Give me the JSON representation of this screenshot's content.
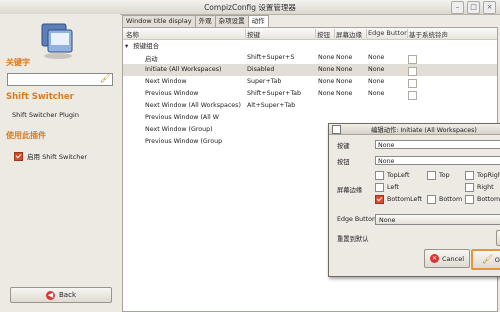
{
  "window": {
    "title": "CompizConfig 设置管理器"
  },
  "sidebar": {
    "filter_label": "关键字",
    "filter_value": "",
    "plugin_title": "Shift Switcher",
    "plugin_name": "Shift Switcher Plugin",
    "use_plugin_label": "使用此插件",
    "enable_label": "启用 Shift Switcher",
    "back_label": "Back"
  },
  "tabs": [
    "Window title display",
    "外观",
    "杂项设置",
    "动作"
  ],
  "active_tab": 3,
  "table": {
    "headers": [
      "名称",
      "按键",
      "按钮",
      "屏幕边缘",
      "Edge Button",
      "基于系统铃声"
    ],
    "group": "按键组合",
    "rows": [
      {
        "name": "启动",
        "key": "Shift+Super+S",
        "button": "None",
        "edge": "None",
        "edge_button": "None"
      },
      {
        "name": "Initiate (All Workspaces)",
        "key": "Disabled",
        "button": "None",
        "edge": "None",
        "edge_button": "None"
      },
      {
        "name": "Next Window",
        "key": "Super+Tab",
        "button": "None",
        "edge": "None",
        "edge_button": "None"
      },
      {
        "name": "Previous Window",
        "key": "Shift+Super+Tab",
        "button": "None",
        "edge": "None",
        "edge_button": "None"
      },
      {
        "name": "Next Window (All Workspaces)",
        "key": "Alt+Super+Tab",
        "button": "",
        "edge": "",
        "edge_button": ""
      },
      {
        "name": "Previous Window (All W",
        "key": "",
        "button": "",
        "edge": "",
        "edge_button": ""
      },
      {
        "name": "Next Window (Group)",
        "key": "",
        "button": "",
        "edge": "",
        "edge_button": ""
      },
      {
        "name": "Previous Window (Group",
        "key": "",
        "button": "",
        "edge": "",
        "edge_button": ""
      }
    ]
  },
  "dialog": {
    "title": "编辑动作: Initiate (All Workspaces)",
    "key_label": "按键",
    "key_value": "None",
    "button_label": "按钮",
    "button_value": "None",
    "edge_label": "屏幕边缘",
    "edges": [
      {
        "label": "TopLeft",
        "checked": false
      },
      {
        "label": "Top",
        "checked": false
      },
      {
        "label": "TopRight",
        "checked": false
      },
      {
        "label": "Left",
        "checked": false
      },
      {
        "label": "Right",
        "checked": false
      },
      {
        "label": "BottomLeft",
        "checked": true
      },
      {
        "label": "Bottom",
        "checked": false
      },
      {
        "label": "BottomRight",
        "checked": false
      }
    ],
    "edge_button_label": "Edge Button",
    "edge_button_value": "None",
    "reset_label": "重置到默认",
    "cancel_label": "Cancel",
    "ok_label": "OK"
  },
  "colors": {
    "accent": "#e07b1a",
    "checkbox_on": "#d94b2b"
  }
}
